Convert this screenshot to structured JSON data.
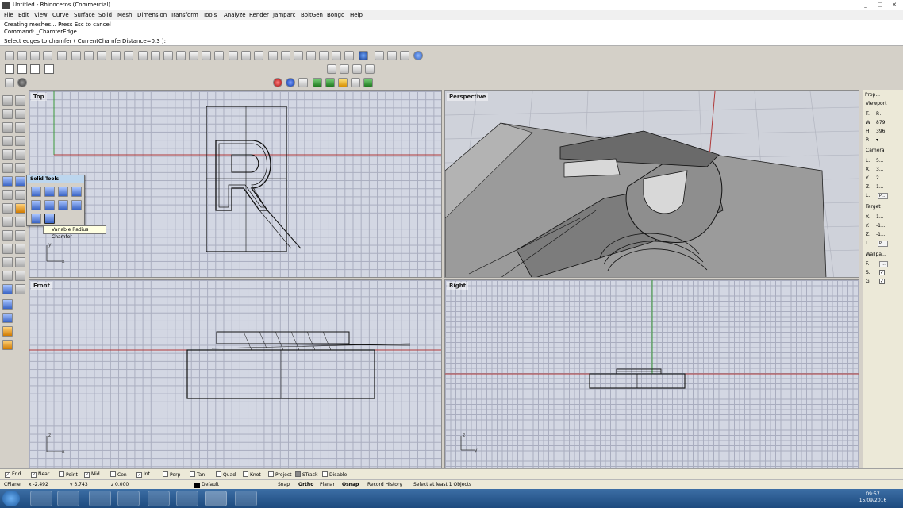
{
  "window": {
    "title": "Untitled - Rhinoceros (Commercial)",
    "controls": [
      "_",
      "□",
      "✕"
    ]
  },
  "menu": [
    "File",
    "Edit",
    "View",
    "Curve",
    "Surface",
    "Solid",
    "Mesh",
    "Dimension",
    "Transform",
    "Tools",
    "Analyze",
    "Render",
    "Jamparc",
    "BoltGen",
    "Bongo",
    "Help"
  ],
  "command": {
    "history": [
      "Creating meshes... Press Esc to cancel",
      "Command: _ChamferEdge"
    ],
    "prompt": "Select edges to chamfer ( CurrentChamferDistance=0.3 ):"
  },
  "viewports": {
    "top": "Top",
    "perspective": "Perspective",
    "front": "Front",
    "right": "Right"
  },
  "axes": {
    "top_y": "y",
    "top_x": "x",
    "front_z": "z",
    "front_x": "x",
    "right_z": "z",
    "right_y": "y"
  },
  "flyout": {
    "title": "Solid Tools",
    "tooltip": "Variable Radius Chamfer"
  },
  "properties": {
    "tab": "Prop...",
    "section": "Viewport",
    "rows": [
      {
        "label": "T.",
        "value": "P..."
      },
      {
        "label": "W",
        "value": "879"
      },
      {
        "label": "H",
        "value": "396"
      },
      {
        "label": "P.",
        "value": "▾"
      }
    ],
    "camera_header": "Camera",
    "camera_rows": [
      {
        "label": "L.",
        "value": "5..."
      },
      {
        "label": "X.",
        "value": "3..."
      },
      {
        "label": "Y.",
        "value": "2..."
      },
      {
        "label": "Z.",
        "value": "1..."
      },
      {
        "label": "L.",
        "value": "Pl..."
      }
    ],
    "target_header": "Target",
    "target_rows": [
      {
        "label": "X.",
        "value": "1..."
      },
      {
        "label": "Y.",
        "value": "-1..."
      },
      {
        "label": "Z.",
        "value": "-1..."
      },
      {
        "label": "L.",
        "value": "Pl..."
      }
    ],
    "wallpaper_header": "Wallpa...",
    "wallpaper_rows": [
      {
        "label": "F.",
        "value": "..."
      },
      {
        "label": "S.",
        "value": "✓"
      },
      {
        "label": "G.",
        "value": "✓"
      }
    ]
  },
  "osnap": [
    {
      "label": "End",
      "checked": true
    },
    {
      "label": "Near",
      "checked": true
    },
    {
      "label": "Point",
      "checked": false
    },
    {
      "label": "Mid",
      "checked": true
    },
    {
      "label": "Cen",
      "checked": false
    },
    {
      "label": "Int",
      "checked": true
    },
    {
      "label": "Perp",
      "checked": false
    },
    {
      "label": "Tan",
      "checked": false
    },
    {
      "label": "Quad",
      "checked": false
    },
    {
      "label": "Knot",
      "checked": false
    },
    {
      "label": "Project",
      "checked": false
    },
    {
      "label": "STrack",
      "checked": false
    },
    {
      "label": "Disable",
      "checked": false
    }
  ],
  "status": {
    "cplane": "CPlane",
    "x": "x -2.492",
    "y": "y 3.743",
    "z": "z 0.000",
    "layer": "Default",
    "snap": "Snap",
    "ortho": "Ortho",
    "planar": "Planar",
    "osnap": "Osnap",
    "record": "Record History",
    "message": "Select at least 1 Objects"
  },
  "clock": {
    "time": "09:57",
    "date": "15/09/2016"
  },
  "colors": {
    "viewport_bg": "#d3d7e3",
    "grid": "#a9adbf",
    "x_axis": "#b03a3a",
    "y_axis": "#3a9a3a",
    "taskbar": "#1d4a7e"
  }
}
